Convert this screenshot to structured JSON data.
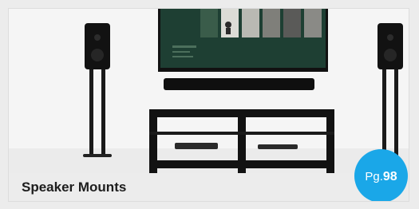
{
  "card": {
    "title": "Speaker Mounts",
    "page_prefix": "Pg.",
    "page_number": "98"
  },
  "colors": {
    "badge": "#1aa7e8",
    "caption_bg": "#ececec",
    "title_text": "#1d1d1d",
    "tv_screen": "#1e3f33",
    "furniture": "#0e0e0e"
  },
  "image": {
    "subject": "living room with TV, soundbar, media stand and floor speakers on stands"
  }
}
